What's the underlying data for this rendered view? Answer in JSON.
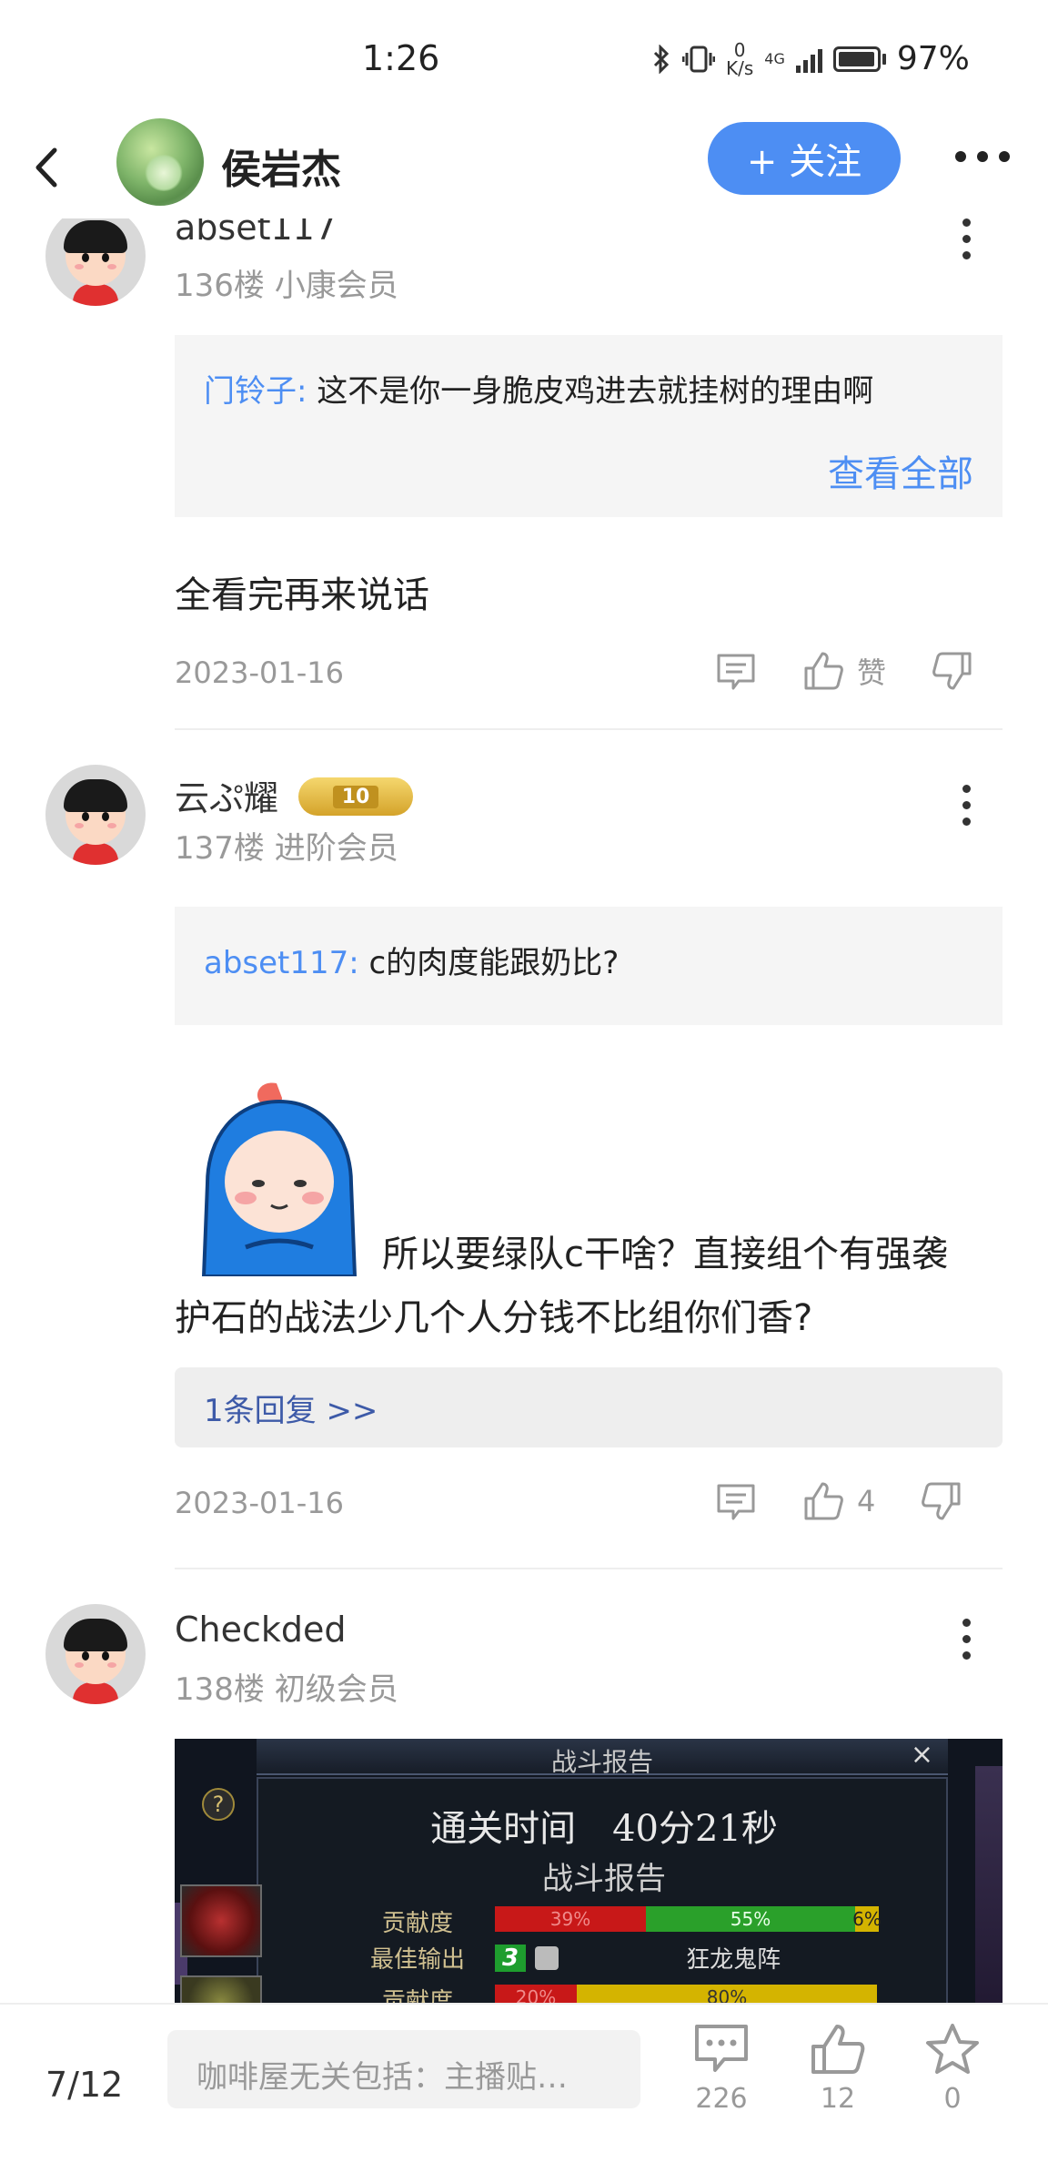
{
  "status_bar": {
    "time": "1:26",
    "net_speed_value": "0",
    "net_speed_unit": "K/s",
    "network": "4G",
    "battery": "97%"
  },
  "header": {
    "username": "侯岩杰",
    "follow_label": "+ 关注",
    "back_icon": "chevron-left-icon",
    "more_icon": "more-horizontal-icon"
  },
  "posts": [
    {
      "username": "abset117",
      "floor_info": "136楼 小康会员",
      "quote_user": "门铃子:",
      "quote_text": "这不是你一身脆皮鸡进去就挂树的理由啊",
      "quote_more": "查看全部",
      "body": "全看完再来说话",
      "date": "2023-01-16",
      "likes": "赞"
    },
    {
      "username": "云ぷ耀",
      "badge": "",
      "floor_info": "137楼 进阶会员",
      "quote_user": "abset117:",
      "quote_text": "c的肉度能跟奶比?",
      "body_line1": "所以要绿队c干啥？直接组个有强袭",
      "body_line2": "护石的战法少几个人分钱不比组你们香?",
      "reply_link": "1条回复 >>",
      "date": "2023-01-16",
      "likes": "4"
    },
    {
      "username": "Checkded",
      "floor_info": "138楼 初级会员",
      "image": {
        "title": "战斗报告",
        "clear_time": "通关时间　40分21秒",
        "subtitle": "战斗报告",
        "row1_label": "贡献度",
        "row1_red": "39%",
        "row1_green": "55%",
        "row1_yellow": "6%",
        "row2_label": "最佳输出",
        "row2_rank": "3",
        "row2_name": "狂龙鬼阵",
        "row3_label": "贡献度",
        "row3_red": "20%",
        "row3_yellow": "80%"
      }
    }
  ],
  "bottom_bar": {
    "page": "7/12",
    "input_placeholder": "咖啡屋无关包括：主播贴…",
    "comments": "226",
    "likes": "12",
    "stars": "0"
  },
  "colors": {
    "accent": "#4d8ef3",
    "quote_user": "#4d8ef3",
    "reply_link": "#3d5aa8",
    "muted": "#999999"
  }
}
